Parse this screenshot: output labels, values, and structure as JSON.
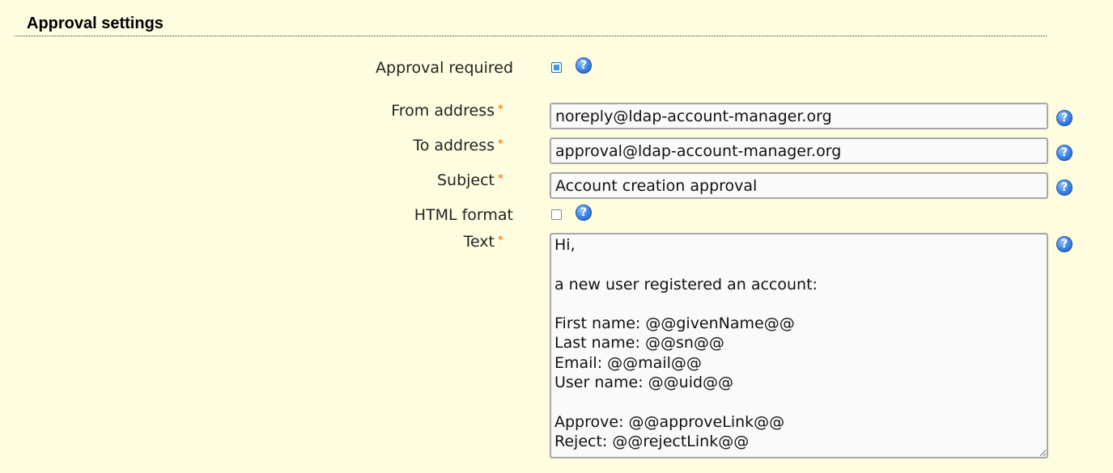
{
  "section": {
    "title": "Approval settings"
  },
  "fields": {
    "approval_required": {
      "label": "Approval required",
      "checked": true,
      "help": "?"
    },
    "from_address": {
      "label": "From address",
      "required_mark": "*",
      "value": "noreply@ldap-account-manager.org",
      "help": "?"
    },
    "to_address": {
      "label": "To address",
      "required_mark": "*",
      "value": "approval@ldap-account-manager.org",
      "help": "?"
    },
    "subject": {
      "label": "Subject",
      "required_mark": "*",
      "value": "Account creation approval",
      "help": "?"
    },
    "html_format": {
      "label": "HTML format",
      "checked": false,
      "help": "?"
    },
    "text": {
      "label": "Text",
      "required_mark": "*",
      "help": "?",
      "value": "Hi,\n\na new user registered an account:\n\nFirst name: @@givenName@@\nLast name: @@sn@@\nEmail: @@mail@@\nUser name: @@uid@@\n\nApprove: @@approveLink@@\nReject: @@rejectLink@@"
    }
  },
  "colors": {
    "background": "#fffde0",
    "required_star": "#f08a3c",
    "help_icon": "#3b82e6",
    "checkbox_checked": "#3a9be0"
  }
}
